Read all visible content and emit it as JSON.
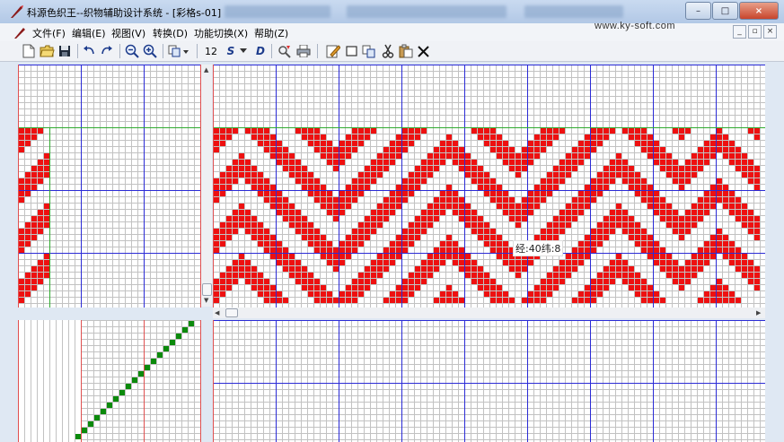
{
  "window": {
    "title": "科源色织王--织物辅助设计系统 - [彩格s-01]",
    "buttons": [
      "–",
      "□",
      "×"
    ]
  },
  "menu": {
    "items": [
      "文件(F)",
      "编辑(E)",
      "视图(V)",
      "转换(D)",
      "功能切换(X)",
      "帮助(Z)"
    ],
    "site_url": "www.ky-soft.com",
    "mdi_buttons": [
      "_",
      "▫",
      "×"
    ]
  },
  "toolbar": {
    "icons": [
      "new-file-icon",
      "open-folder-icon",
      "save-icon",
      "undo-icon",
      "redo-icon",
      "zoom-out-icon",
      "zoom-in-icon",
      "copy-dropdown-icon",
      "s-style-icon",
      "d-style-icon",
      "tool-icon",
      "print-icon",
      "edit-icon",
      "rectangle-icon",
      "paste-icon",
      "cut-icon",
      "clipboard-icon",
      "delete-icon"
    ],
    "size_label": "12",
    "s_label": "S",
    "d_label": "D"
  },
  "status": {
    "coord_label": "经:40纬:8"
  },
  "colors": {
    "fill_red": "#ee1010",
    "fill_green": "#0b8a0b",
    "grid_minor": "#c2c2c2",
    "grid_blue": "#2b2bd6",
    "grid_red": "#e05050",
    "grid_green": "#2faa2f"
  },
  "pattern": {
    "cell": 7,
    "repeat": 8,
    "segments": [
      {
        "from": 0,
        "to": 3,
        "dir": 1
      },
      {
        "from": 4,
        "to": 18,
        "dir": -1
      },
      {
        "from": 19,
        "to": 36,
        "dir": 1
      },
      {
        "from": 37,
        "to": 47,
        "dir": -1
      },
      {
        "from": 48,
        "to": 63,
        "dir": 1
      },
      {
        "from": 64,
        "to": 73,
        "dir": -1
      },
      {
        "from": 74,
        "to": 79,
        "dir": 1
      },
      {
        "from": 80,
        "to": 87,
        "dir": -1
      }
    ]
  }
}
